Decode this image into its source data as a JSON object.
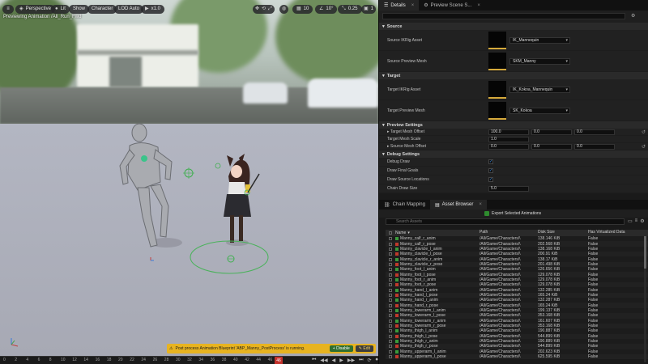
{
  "viewport": {
    "buttons": {
      "menu": "≡",
      "perspective": "Perspective",
      "lit": "Lit",
      "show": "Show",
      "character": "Character",
      "lod": "LOD Auto",
      "speed": "x1.0",
      "grid": "10",
      "angle": "10°",
      "scale": "0.25",
      "cam": "1"
    },
    "anim_label": "Previewing Animation /All_Run_Fwd",
    "notification": {
      "text": "Post process Animation Blueprint 'ABP_Manny_PostProcess' is running.",
      "disable": "Disable",
      "edit": "Edit"
    }
  },
  "timeline": {
    "ticks": [
      "0",
      "2",
      "4",
      "6",
      "8",
      "10",
      "12",
      "14",
      "16",
      "18",
      "20",
      "22",
      "24",
      "26",
      "28",
      "30",
      "32",
      "34",
      "36",
      "38",
      "40",
      "42",
      "44",
      "46"
    ],
    "marker": "46",
    "controls": [
      "⏮",
      "◀◀",
      "◀",
      "▶",
      "▶▶",
      "⏭",
      "⟳",
      "⏺"
    ]
  },
  "panel": {
    "tabs": [
      {
        "label": "Details"
      },
      {
        "label": "Preview Scene S..."
      }
    ],
    "sections": {
      "source": "Source",
      "target": "Target",
      "preview": "Preview Settings",
      "debug": "Debug Settings"
    },
    "source": {
      "ikrig_label": "Source IKRig Asset",
      "ikrig_value": "IK_Mannequin",
      "mesh_label": "Source Preview Mesh",
      "mesh_value": "SKM_Manny"
    },
    "target": {
      "ikrig_label": "Target IKRig Asset",
      "ikrig_value": "IK_Kokoa_Mannequin",
      "mesh_label": "Target Preview Mesh",
      "mesh_value": "SK_Kokoa"
    },
    "preview": {
      "offset_label": "Target Mesh Offset",
      "offset": [
        "100.0",
        "0.0",
        "0.0"
      ],
      "scale_label": "Target Mesh Scale",
      "scale": "1.0",
      "src_offset_label": "Source Mesh Offset",
      "src_offset": [
        "0.0",
        "0.0",
        "0.0"
      ]
    },
    "debug": {
      "draw_label": "Debug Draw",
      "final_label": "Draw Final Goals",
      "source_label": "Draw Source Locations",
      "chain_label": "Chain Draw Size",
      "chain_value": "5.0"
    },
    "bottom_tabs": [
      {
        "label": "Chain Mapping"
      },
      {
        "label": "Asset Browser"
      }
    ],
    "export_label": "Export Selected Animations",
    "search_placeholder": "Search Assets",
    "columns": [
      "Name",
      "Path",
      "Disk Size",
      "Has Virtualized Data"
    ],
    "rows": [
      {
        "name": "Manny_calf_r_anim",
        "path": "/All/Game/Characters/\\",
        "size": "138.146 KiB",
        "virt": "False",
        "color": "#3a9a3a"
      },
      {
        "name": "Manny_calf_r_pose",
        "path": "/All/Game/Characters/\\",
        "size": "202.568 KiB",
        "virt": "False",
        "color": "#c0392b"
      },
      {
        "name": "Manny_clavicle_l_anim",
        "path": "/All/Game/Characters/\\",
        "size": "138.168 KiB",
        "virt": "False",
        "color": "#3a9a3a"
      },
      {
        "name": "Manny_clavicle_l_pose",
        "path": "/All/Game/Characters/\\",
        "size": "200.91 KiB",
        "virt": "False",
        "color": "#c0392b"
      },
      {
        "name": "Manny_clavicle_r_anim",
        "path": "/All/Game/Characters/\\",
        "size": "138.17 KiB",
        "virt": "False",
        "color": "#3a9a3a"
      },
      {
        "name": "Manny_clavicle_r_pose",
        "path": "/All/Game/Characters/\\",
        "size": "201.498 KiB",
        "virt": "False",
        "color": "#c0392b"
      },
      {
        "name": "Manny_foot_l_anim",
        "path": "/All/Game/Characters/\\",
        "size": "126.656 KiB",
        "virt": "False",
        "color": "#3a9a3a"
      },
      {
        "name": "Manny_foot_l_pose",
        "path": "/All/Game/Characters/\\",
        "size": "129.078 KiB",
        "virt": "False",
        "color": "#c0392b"
      },
      {
        "name": "Manny_foot_r_anim",
        "path": "/All/Game/Characters/\\",
        "size": "129.078 KiB",
        "virt": "False",
        "color": "#3a9a3a"
      },
      {
        "name": "Manny_foot_r_pose",
        "path": "/All/Game/Characters/\\",
        "size": "129.078 KiB",
        "virt": "False",
        "color": "#c0392b"
      },
      {
        "name": "Manny_hand_l_anim",
        "path": "/All/Game/Characters/\\",
        "size": "132.285 KiB",
        "virt": "False",
        "color": "#3a9a3a"
      },
      {
        "name": "Manny_hand_l_pose",
        "path": "/All/Game/Characters/\\",
        "size": "165.24 KiB",
        "virt": "False",
        "color": "#c0392b"
      },
      {
        "name": "Manny_hand_r_anim",
        "path": "/All/Game/Characters/\\",
        "size": "132.287 KiB",
        "virt": "False",
        "color": "#3a9a3a"
      },
      {
        "name": "Manny_hand_r_pose",
        "path": "/All/Game/Characters/\\",
        "size": "165.24 KiB",
        "virt": "False",
        "color": "#c0392b"
      },
      {
        "name": "Manny_lowerarm_l_anim",
        "path": "/All/Game/Characters/\\",
        "size": "199.137 KiB",
        "virt": "False",
        "color": "#3a9a3a"
      },
      {
        "name": "Manny_lowerarm_l_pose",
        "path": "/All/Game/Characters/\\",
        "size": "353.168 KiB",
        "virt": "False",
        "color": "#c0392b"
      },
      {
        "name": "Manny_lowerarm_r_anim",
        "path": "/All/Game/Characters/\\",
        "size": "161.607 KiB",
        "virt": "False",
        "color": "#3a9a3a"
      },
      {
        "name": "Manny_lowerarm_r_pose",
        "path": "/All/Game/Characters/\\",
        "size": "353.168 KiB",
        "virt": "False",
        "color": "#c0392b"
      },
      {
        "name": "Manny_thigh_l_anim",
        "path": "/All/Game/Characters/\\",
        "size": "190.887 KiB",
        "virt": "False",
        "color": "#3a9a3a"
      },
      {
        "name": "Manny_thigh_l_pose",
        "path": "/All/Game/Characters/\\",
        "size": "544.899 KiB",
        "virt": "False",
        "color": "#c0392b"
      },
      {
        "name": "Manny_thigh_r_anim",
        "path": "/All/Game/Characters/\\",
        "size": "190.889 KiB",
        "virt": "False",
        "color": "#3a9a3a"
      },
      {
        "name": "Manny_thigh_r_pose",
        "path": "/All/Game/Characters/\\",
        "size": "544.899 KiB",
        "virt": "False",
        "color": "#c0392b"
      },
      {
        "name": "Manny_upperarm_l_anim",
        "path": "/All/Game/Characters/\\",
        "size": "202.623 KiB",
        "virt": "False",
        "color": "#3a9a3a"
      },
      {
        "name": "Manny_upperarm_l_pose",
        "path": "/All/Game/Characters/\\",
        "size": "625.595 KiB",
        "virt": "False",
        "color": "#c0392b"
      }
    ]
  },
  "icons": {
    "reset": "↺",
    "expand": "▸",
    "collapse": "▾",
    "dropdown": "▾",
    "search": "⌕",
    "check": "✓",
    "warning": "⚠",
    "settings": "⚙"
  },
  "colors": {
    "accent_warning": "#e7b320",
    "anim_icon": "#3a9a3a",
    "pose_icon": "#c0392b",
    "timeline_marker": "#c4322c"
  }
}
